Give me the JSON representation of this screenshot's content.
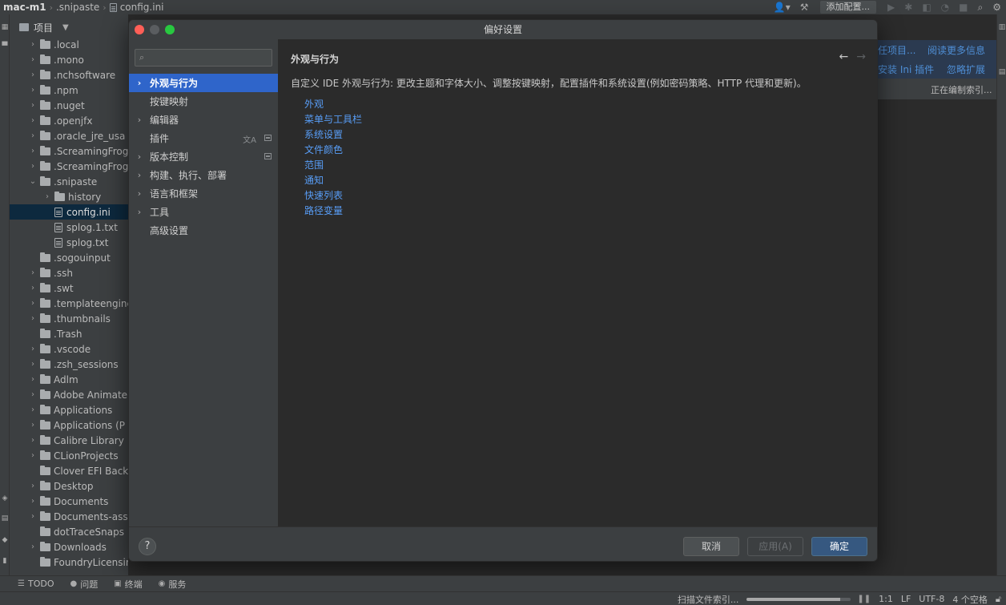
{
  "navbar": {
    "project": "mac-m1",
    "folder": ".snipaste",
    "file": "config.ini",
    "run_config": "添加配置..."
  },
  "project_panel": {
    "title": "项目",
    "tree": [
      {
        "label": ".local",
        "depth": 0,
        "expandable": true
      },
      {
        "label": ".mono",
        "depth": 0,
        "expandable": true
      },
      {
        "label": ".nchsoftware",
        "depth": 0,
        "expandable": true
      },
      {
        "label": ".npm",
        "depth": 0,
        "expandable": true
      },
      {
        "label": ".nuget",
        "depth": 0,
        "expandable": true
      },
      {
        "label": ".openjfx",
        "depth": 0,
        "expandable": true
      },
      {
        "label": ".oracle_jre_usa",
        "depth": 0,
        "expandable": true
      },
      {
        "label": ".ScreamingFrog",
        "depth": 0,
        "expandable": true
      },
      {
        "label": ".ScreamingFrog",
        "depth": 0,
        "expandable": true
      },
      {
        "label": ".snipaste",
        "depth": 0,
        "expandable": true,
        "expanded": true
      },
      {
        "label": "history",
        "depth": 1,
        "expandable": true
      },
      {
        "label": "config.ini",
        "depth": 1,
        "file": true,
        "selected": true
      },
      {
        "label": "splog.1.txt",
        "depth": 1,
        "file": true
      },
      {
        "label": "splog.txt",
        "depth": 1,
        "file": true
      },
      {
        "label": ".sogouinput",
        "depth": 0,
        "expandable": false
      },
      {
        "label": ".ssh",
        "depth": 0,
        "expandable": true
      },
      {
        "label": ".swt",
        "depth": 0,
        "expandable": true
      },
      {
        "label": ".templateengine",
        "depth": 0,
        "expandable": true
      },
      {
        "label": ".thumbnails",
        "depth": 0,
        "expandable": true
      },
      {
        "label": ".Trash",
        "depth": 0,
        "expandable": false
      },
      {
        "label": ".vscode",
        "depth": 0,
        "expandable": true
      },
      {
        "label": ".zsh_sessions",
        "depth": 0,
        "expandable": true
      },
      {
        "label": "Adlm",
        "depth": 0,
        "expandable": true
      },
      {
        "label": "Adobe Animate",
        "depth": 0,
        "expandable": true
      },
      {
        "label": "Applications",
        "depth": 0,
        "expandable": true
      },
      {
        "label": "Applications (P",
        "depth": 0,
        "expandable": true
      },
      {
        "label": "Calibre Library",
        "depth": 0,
        "expandable": true
      },
      {
        "label": "CLionProjects",
        "depth": 0,
        "expandable": true
      },
      {
        "label": "Clover EFI Back",
        "depth": 0,
        "expandable": false
      },
      {
        "label": "Desktop",
        "depth": 0,
        "expandable": true
      },
      {
        "label": "Documents",
        "depth": 0,
        "expandable": true
      },
      {
        "label": "Documents-ass",
        "depth": 0,
        "expandable": true
      },
      {
        "label": "dotTraceSnaps",
        "depth": 0,
        "expandable": false
      },
      {
        "label": "Downloads",
        "depth": 0,
        "expandable": true
      },
      {
        "label": "FoundryLicensing",
        "depth": 0,
        "expandable": false
      }
    ]
  },
  "banner": {
    "line1_a": "任项目...",
    "line1_b": "阅读更多信息",
    "line2_a": "安装 Ini 插件",
    "line2_b": "忽略扩展",
    "indexing": "正在编制索引..."
  },
  "dialog": {
    "title": "偏好设置",
    "search_placeholder": "",
    "nav": [
      {
        "label": "外观与行为",
        "chevron": true,
        "active": true
      },
      {
        "label": "按键映射",
        "chevron": false
      },
      {
        "label": "编辑器",
        "chevron": true
      },
      {
        "label": "插件",
        "chevron": false,
        "badges": true
      },
      {
        "label": "版本控制",
        "chevron": true,
        "badge_sq": true
      },
      {
        "label": "构建、执行、部署",
        "chevron": true
      },
      {
        "label": "语言和框架",
        "chevron": true
      },
      {
        "label": "工具",
        "chevron": true
      },
      {
        "label": "高级设置",
        "chevron": false
      }
    ],
    "page_title": "外观与行为",
    "description": "自定义 IDE 外观与行为: 更改主题和字体大小、调整按键映射，配置插件和系统设置(例如密码策略、HTTP 代理和更新)。",
    "links": [
      "外观",
      "菜单与工具栏",
      "系统设置",
      "文件颜色",
      "范围",
      "通知",
      "快速列表",
      "路径变量"
    ],
    "help": "?",
    "cancel_label": "取消",
    "apply_label": "应用(A)",
    "ok_label": "确定"
  },
  "tool_windows": {
    "todo": "TODO",
    "problems": "问题",
    "terminal": "终端",
    "services": "服务"
  },
  "status": {
    "scanning": "扫描文件索引...",
    "progress": 0.9,
    "position": "1:1",
    "line_sep": "LF",
    "encoding": "UTF-8",
    "indent": "4 个空格"
  },
  "colors": {
    "accent": "#2f65ca",
    "link": "#589df6",
    "ok_button": "#365880"
  }
}
